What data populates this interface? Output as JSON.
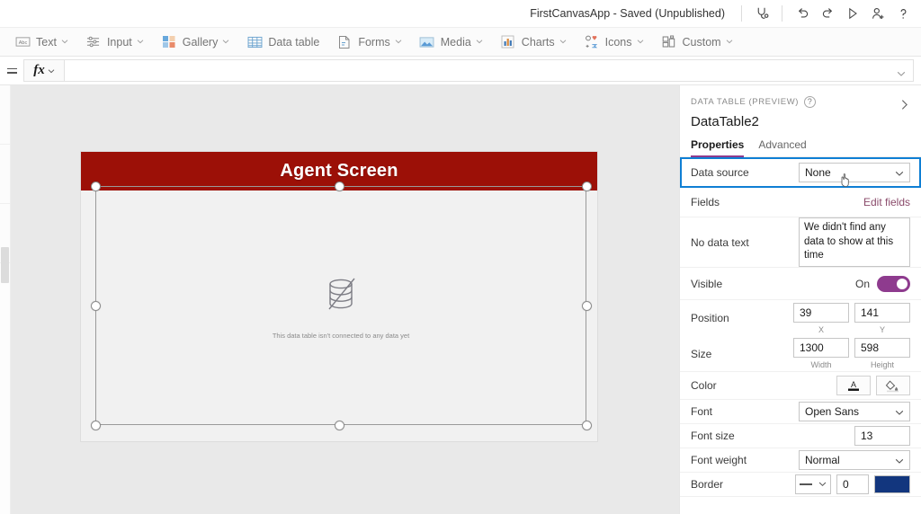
{
  "topbar": {
    "app_title": "FirstCanvasApp - Saved (Unpublished)",
    "icons": [
      {
        "name": "app-checker-icon",
        "label": "App checker"
      },
      {
        "name": "undo-icon",
        "label": "Undo"
      },
      {
        "name": "redo-icon",
        "label": "Redo"
      },
      {
        "name": "preview-play-icon",
        "label": "Preview the app"
      },
      {
        "name": "share-add-user-icon",
        "label": "Share"
      },
      {
        "name": "help-icon",
        "label": "Help"
      }
    ]
  },
  "ribbon": {
    "items": [
      {
        "label": "Text",
        "icon": "text-abc-icon",
        "caret": true
      },
      {
        "label": "Input",
        "icon": "input-sliders-icon",
        "caret": true
      },
      {
        "label": "Gallery",
        "icon": "gallery-icon",
        "caret": true
      },
      {
        "label": "Data table",
        "icon": "data-table-icon",
        "caret": false
      },
      {
        "label": "Forms",
        "icon": "forms-icon",
        "caret": true
      },
      {
        "label": "Media",
        "icon": "media-image-icon",
        "caret": true
      },
      {
        "label": "Charts",
        "icon": "charts-bar-icon",
        "caret": true
      },
      {
        "label": "Icons",
        "icon": "icons-shapes-icon",
        "caret": true
      },
      {
        "label": "Custom",
        "icon": "custom-components-icon",
        "caret": true
      }
    ]
  },
  "formula_bar": {
    "fx_label": "fx",
    "value": "",
    "placeholder": ""
  },
  "canvas": {
    "screen_title": "Agent Screen",
    "screen_header_color": "#9c1007",
    "data_table_empty_text": "This data table isn't connected to any data yet"
  },
  "panel": {
    "kicker": "DATA TABLE (PREVIEW)",
    "help_glyph": "?",
    "control_name": "DataTable2",
    "tabs": [
      {
        "label": "Properties",
        "active": true
      },
      {
        "label": "Advanced",
        "active": false
      }
    ],
    "accent_color": "#8e3b8e",
    "focus_color": "#0f7fd4",
    "properties": {
      "data_source_label": "Data source",
      "data_source_value": "None",
      "fields_label": "Fields",
      "edit_fields_link": "Edit fields",
      "no_data_text_label": "No data text",
      "no_data_text_value": "We didn't find any data to show at this time",
      "visible_label": "Visible",
      "visible_state": "On",
      "position_label": "Position",
      "position_x": "39",
      "position_y": "141",
      "position_x_sublabel": "X",
      "position_y_sublabel": "Y",
      "size_label": "Size",
      "size_width": "1300",
      "size_height": "598",
      "size_width_sublabel": "Width",
      "size_height_sublabel": "Height",
      "color_label": "Color",
      "font_label": "Font",
      "font_value": "Open Sans",
      "font_size_label": "Font size",
      "font_size_value": "13",
      "font_weight_label": "Font weight",
      "font_weight_value": "Normal",
      "border_label": "Border",
      "border_width_value": "0",
      "border_color": "#12367e"
    }
  }
}
